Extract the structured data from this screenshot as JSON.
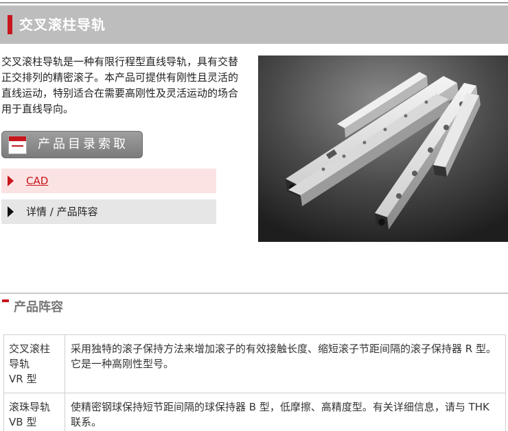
{
  "header": {
    "title": "交叉滚柱导轨"
  },
  "intro": {
    "description": "交叉滚柱导轨是一种有限行程型直线导轨，具有交替正交排列的精密滚子。本产品可提供有刚性且灵活的直线运动，特别适合在需要高刚性及灵活运动的场合用于直线导向。"
  },
  "catalog_button": {
    "label": "产品目录索取",
    "icon": "catalog-book-icon"
  },
  "nav": {
    "cad_label": "CAD",
    "detail_label": "详情 / 产品阵容"
  },
  "lineup": {
    "section_title": "产品阵容",
    "rows": [
      {
        "name_lines": [
          "交叉滚柱",
          "导轨",
          "VR 型"
        ],
        "description": "采用独特的滚子保持方法来增加滚子的有效接触长度、缩短滚子节距间隔的滚子保持器 R 型。它是一种高刚性型号。"
      },
      {
        "name_lines": [
          "滚珠导轨",
          "VB 型"
        ],
        "description": "使精密钢球保持短节距间隔的球保持器 B 型，低摩擦、高精度型。有关详细信息，请与 THK 联系。"
      }
    ]
  },
  "colors": {
    "accent": "#c8161d",
    "title_bar": "#bdbdbd",
    "cad_bg": "#fbe3e3",
    "detail_bg": "#e6e6e6"
  }
}
